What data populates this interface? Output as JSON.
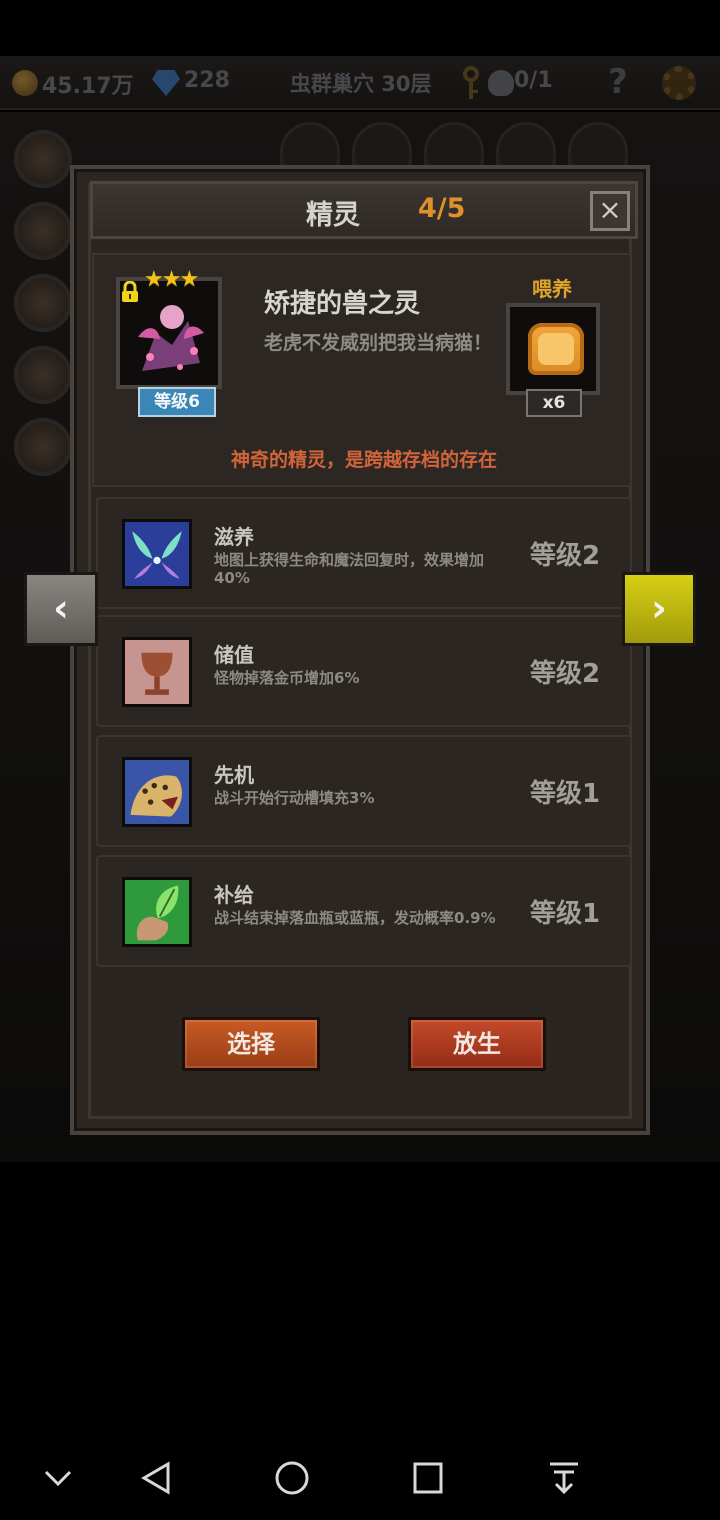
{
  "hud": {
    "gold": "45.17万",
    "gems": "228",
    "location": "虫群巢穴 30层",
    "keys": "0/1",
    "help": "?"
  },
  "modal": {
    "title": "精灵",
    "count": "4/5",
    "close": "×"
  },
  "spirit": {
    "name": "矫捷的兽之灵",
    "description": "老虎不发威别把我当病猫！",
    "level": "等级6",
    "star_count": 3,
    "stars": "★★★",
    "feed_label": "喂养",
    "feed_quantity": "x6",
    "tagline": "神奇的精灵，是跨越存档的存在"
  },
  "skills": [
    {
      "name": "滋养",
      "description": "地图上获得生命和魔法回复时，效果增加40%",
      "level": "等级2",
      "icon": "fairy-icon"
    },
    {
      "name": "储值",
      "description": "怪物掉落金币增加6%",
      "level": "等级2",
      "icon": "goblet-icon"
    },
    {
      "name": "先机",
      "description": "战斗开始行动槽填充3%",
      "level": "等级1",
      "icon": "leopard-icon"
    },
    {
      "name": "补给",
      "description": "战斗结束掉落血瓶或蓝瓶，发动概率0.9%",
      "level": "等级1",
      "icon": "leaf-hand-icon"
    }
  ],
  "actions": {
    "select": "选择",
    "release": "放生"
  },
  "nav": {
    "prev": "‹",
    "next": "›"
  },
  "colors": {
    "accent_orange": "#e0912a",
    "tagline_red": "#d2643a",
    "next_arrow_yellow": "#d6cf14",
    "level_badge_blue": "#3a86b7"
  }
}
